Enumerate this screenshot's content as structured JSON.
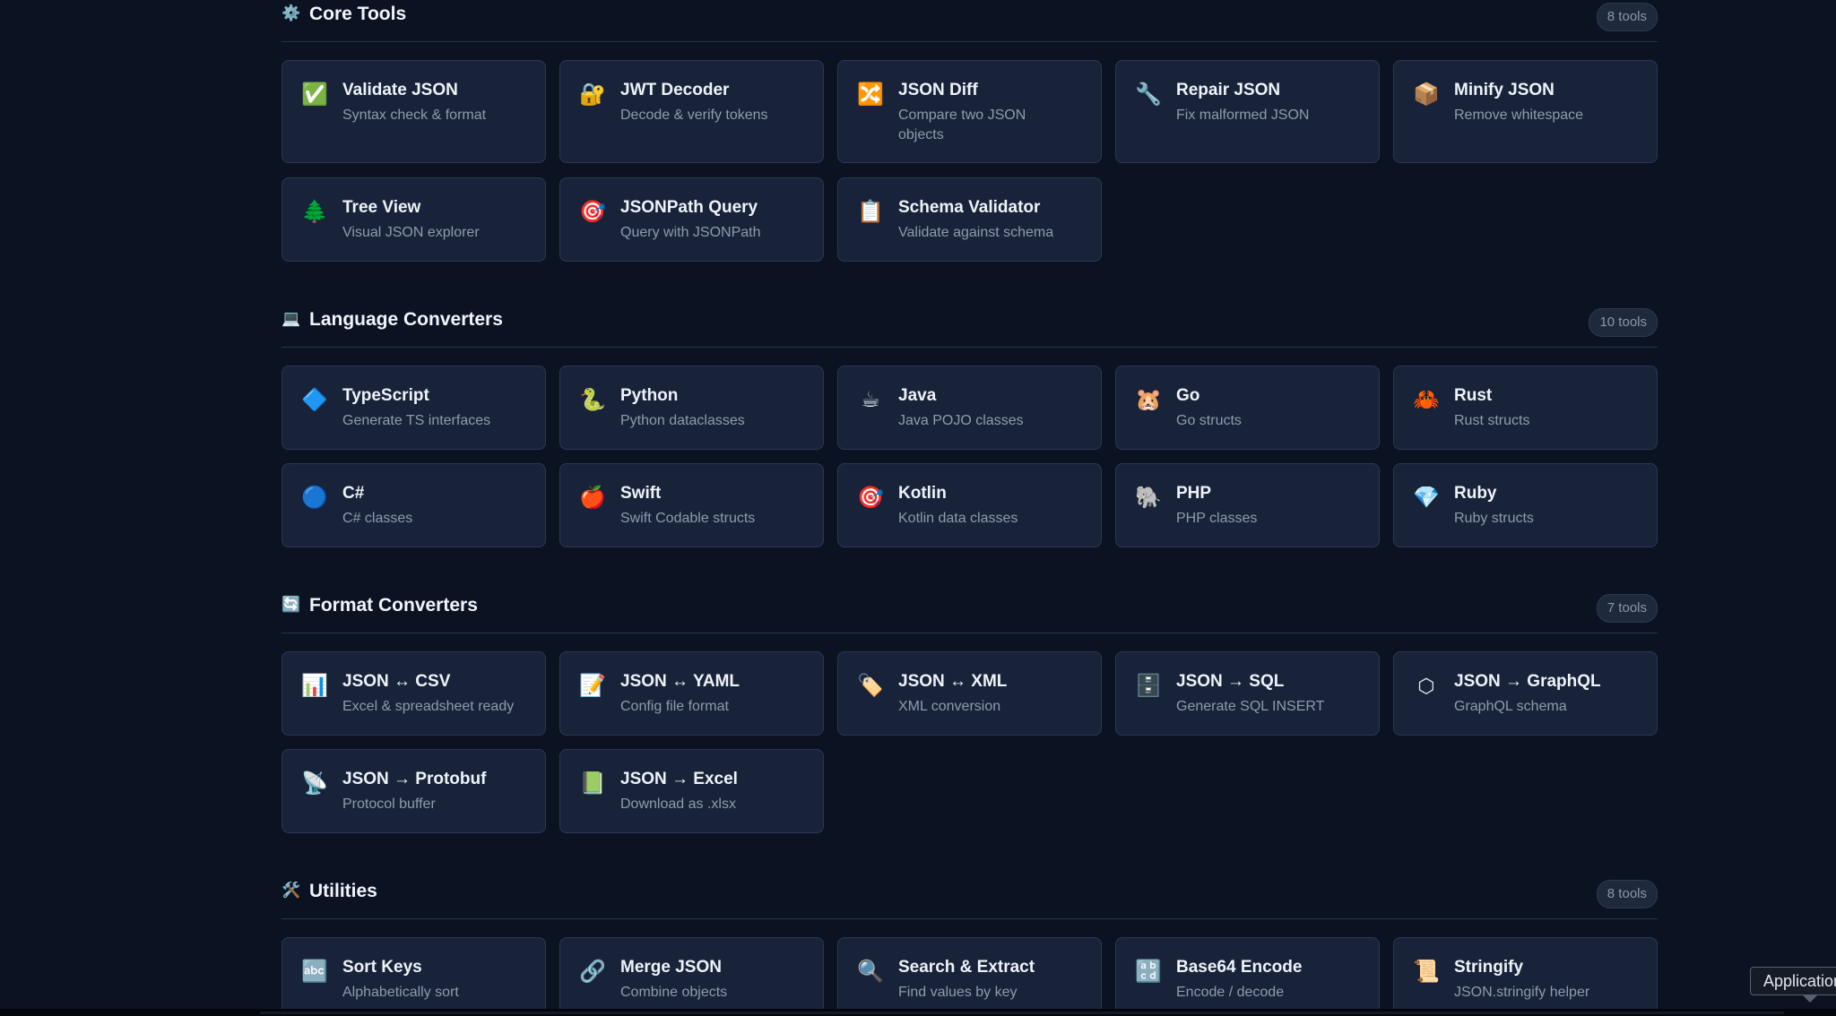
{
  "sections": [
    {
      "icon": "gear-icon",
      "icon_glyph": "⚙️",
      "title": "Core Tools",
      "count": "8 tools",
      "tools": [
        {
          "icon": "check-mark-icon",
          "glyph": "✅",
          "name": "Validate JSON",
          "desc": "Syntax check & format"
        },
        {
          "icon": "lock-key-icon",
          "glyph": "🔐",
          "name": "JWT Decoder",
          "desc": "Decode & verify tokens"
        },
        {
          "icon": "shuffle-icon",
          "glyph": "🔀",
          "name": "JSON Diff",
          "desc": "Compare two JSON objects"
        },
        {
          "icon": "wrench-icon",
          "glyph": "🔧",
          "name": "Repair JSON",
          "desc": "Fix malformed JSON"
        },
        {
          "icon": "package-icon",
          "glyph": "📦",
          "name": "Minify JSON",
          "desc": "Remove whitespace"
        },
        {
          "icon": "tree-icon",
          "glyph": "🌲",
          "name": "Tree View",
          "desc": "Visual JSON explorer"
        },
        {
          "icon": "target-icon",
          "glyph": "🎯",
          "name": "JSONPath Query",
          "desc": "Query with JSONPath"
        },
        {
          "icon": "clipboard-icon",
          "glyph": "📋",
          "name": "Schema Validator",
          "desc": "Validate against schema"
        }
      ]
    },
    {
      "icon": "laptop-icon",
      "icon_glyph": "💻",
      "title": "Language Converters",
      "count": "10 tools",
      "tools": [
        {
          "icon": "blue-diamond-icon",
          "glyph": "🔷",
          "name": "TypeScript",
          "desc": "Generate TS interfaces"
        },
        {
          "icon": "snake-icon",
          "glyph": "🐍",
          "name": "Python",
          "desc": "Python dataclasses"
        },
        {
          "icon": "coffee-icon",
          "glyph": "☕",
          "name": "Java",
          "desc": "Java POJO classes"
        },
        {
          "icon": "hamster-icon",
          "glyph": "🐹",
          "name": "Go",
          "desc": "Go structs"
        },
        {
          "icon": "crab-icon",
          "glyph": "🦀",
          "name": "Rust",
          "desc": "Rust structs"
        },
        {
          "icon": "blue-circle-icon",
          "glyph": "🔵",
          "name": "C#",
          "desc": "C# classes"
        },
        {
          "icon": "apple-icon",
          "glyph": "🍎",
          "name": "Swift",
          "desc": "Swift Codable structs"
        },
        {
          "icon": "target-icon",
          "glyph": "🎯",
          "name": "Kotlin",
          "desc": "Kotlin data classes"
        },
        {
          "icon": "elephant-icon",
          "glyph": "🐘",
          "name": "PHP",
          "desc": "PHP classes"
        },
        {
          "icon": "gem-icon",
          "glyph": "💎",
          "name": "Ruby",
          "desc": "Ruby structs"
        }
      ]
    },
    {
      "icon": "refresh-icon",
      "icon_glyph": "🔄",
      "title": "Format Converters",
      "count": "7 tools",
      "tools": [
        {
          "icon": "bar-chart-icon",
          "glyph": "📊",
          "name": "JSON ↔ CSV",
          "desc": "Excel & spreadsheet ready"
        },
        {
          "icon": "memo-icon",
          "glyph": "📝",
          "name": "JSON ↔ YAML",
          "desc": "Config file format"
        },
        {
          "icon": "tag-icon",
          "glyph": "🏷️",
          "name": "JSON ↔ XML",
          "desc": "XML conversion"
        },
        {
          "icon": "file-cabinet-icon",
          "glyph": "🗄️",
          "name": "JSON → SQL",
          "desc": "Generate SQL INSERT"
        },
        {
          "icon": "hexagon-icon",
          "glyph": "⬡",
          "name": "JSON → GraphQL",
          "desc": "GraphQL schema"
        },
        {
          "icon": "satellite-dish-icon",
          "glyph": "📡",
          "name": "JSON → Protobuf",
          "desc": "Protocol buffer"
        },
        {
          "icon": "green-book-icon",
          "glyph": "📗",
          "name": "JSON → Excel",
          "desc": "Download as .xlsx"
        }
      ]
    },
    {
      "icon": "hammer-wrench-icon",
      "icon_glyph": "🛠️",
      "title": "Utilities",
      "count": "8 tools",
      "tools": [
        {
          "icon": "abc-icon",
          "glyph": "🔤",
          "name": "Sort Keys",
          "desc": "Alphabetically sort"
        },
        {
          "icon": "link-icon",
          "glyph": "🔗",
          "name": "Merge JSON",
          "desc": "Combine objects"
        },
        {
          "icon": "magnifier-icon",
          "glyph": "🔍",
          "name": "Search & Extract",
          "desc": "Find values by key"
        },
        {
          "icon": "abcd-icon",
          "glyph": "🔡",
          "name": "Base64 Encode",
          "desc": "Encode / decode"
        },
        {
          "icon": "scroll-icon",
          "glyph": "📜",
          "name": "Stringify",
          "desc": "JSON.stringify helper"
        }
      ]
    }
  ],
  "tooltip": {
    "label": "Application"
  }
}
